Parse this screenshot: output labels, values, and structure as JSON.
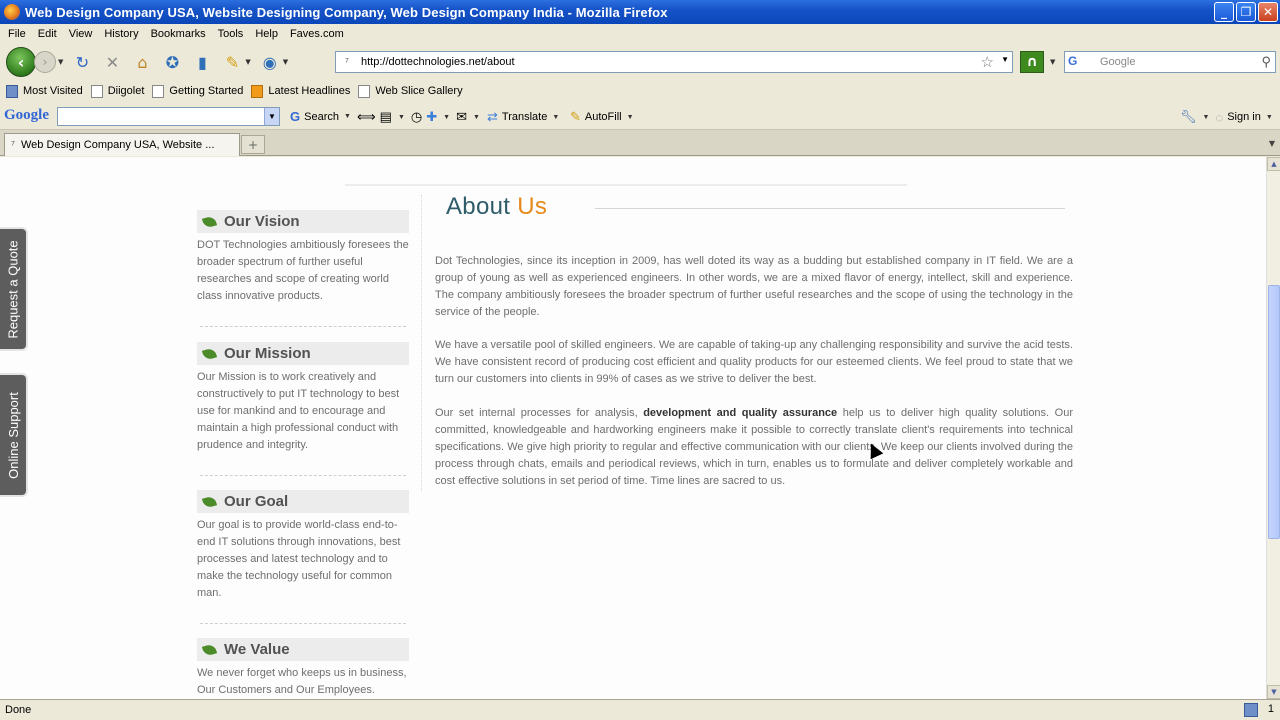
{
  "window": {
    "title": "Web Design Company USA, Website Designing Company, Web Design Company India - Mozilla Firefox"
  },
  "menu": [
    "File",
    "Edit",
    "View",
    "History",
    "Bookmarks",
    "Tools",
    "Help",
    "Faves.com"
  ],
  "address": {
    "url": "http://dottechnologies.net/about"
  },
  "search": {
    "placeholder": "Google"
  },
  "bookmarks": [
    "Most Visited",
    "Diigolet",
    "Getting Started",
    "Latest Headlines",
    "Web Slice Gallery"
  ],
  "google_toolbar": {
    "logo": "Google",
    "search_label": "Search",
    "translate_label": "Translate",
    "autofill_label": "AutoFill",
    "signin_label": "Sign in"
  },
  "tab": {
    "label": "Web Design Company USA, Website ..."
  },
  "side_tabs": {
    "quote": "Request a Quote",
    "support": "Online Support"
  },
  "left_boxes": [
    {
      "title": "Our Vision",
      "text": "DOT Technologies ambitiously foresees the broader spectrum of further useful researches and scope of creating world class innovative products."
    },
    {
      "title": "Our Mission",
      "text": "Our Mission is to work creatively and constructively to put IT technology to best use for mankind and to encourage and maintain a high professional conduct with prudence and integrity."
    },
    {
      "title": "Our Goal",
      "text": "Our goal is to provide world-class end-to-end IT solutions through innovations, best processes and latest technology and to make the technology useful for common man."
    },
    {
      "title": "We Value",
      "text": "We never forget who keeps us in business, Our Customers and Our Employees."
    }
  ],
  "about": {
    "title_word1": "About",
    "title_word2": "Us",
    "p1": "Dot Technologies, since its inception in 2009, has well doted its way as a budding but established company in IT field. We are a group of young as well as experienced engineers. In other words, we are a mixed flavor of energy, intellect, skill and experience. The company ambitiously foresees the broader spectrum of further useful researches and the scope of using the technology in the service of the people.",
    "p2": "We have a versatile pool of skilled engineers. We are capable of taking-up any challenging responsibility and survive the acid tests. We have consistent record of producing cost efficient and quality products for our esteemed clients. We feel proud to state that we turn our customers into clients in 99% of cases as we strive to deliver the best.",
    "p3_before": "Our set internal processes for analysis, ",
    "p3_bold": "development and quality assurance",
    "p3_after": " help us to deliver high quality solutions. Our committed, knowledgeable and hardworking engineers make it possible to correctly translate client's requirements into technical specifications. We give high priority to regular and effective communication with our clients. We keep our clients involved during the process through chats, emails and periodical reviews, which in turn, enables us to formulate and deliver completely workable and cost effective solutions in set period of time. Time lines are sacred to us."
  },
  "status": {
    "text": "Done",
    "right": "1"
  },
  "colors": {
    "accent_orange": "#e58a1a",
    "title_teal": "#2f5c6b",
    "leaf_green": "#4c8b2a"
  }
}
